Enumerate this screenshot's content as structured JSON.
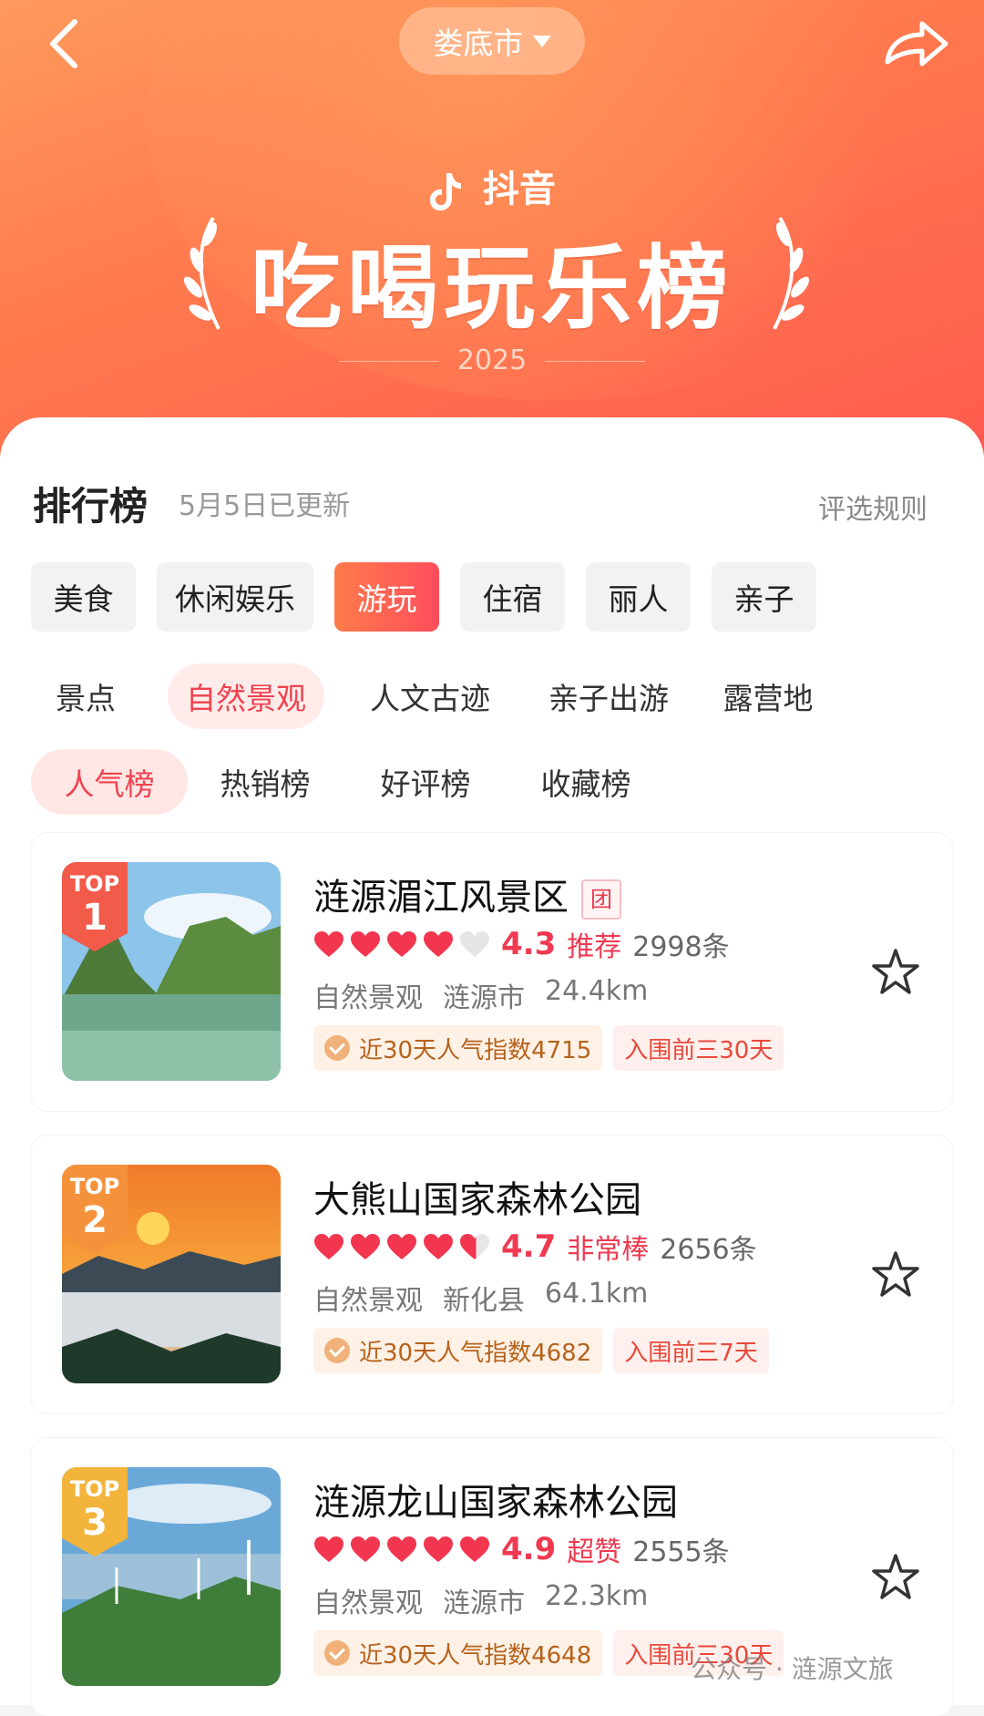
{
  "header": {
    "city": "娄底市",
    "brand": "抖音",
    "title": "吃喝玩乐榜",
    "year": "2025"
  },
  "section": {
    "title": "排行榜",
    "updated": "5月5日已更新",
    "rules": "评选规则"
  },
  "categories": [
    "美食",
    "休闲娱乐",
    "游玩",
    "住宿",
    "丽人",
    "亲子"
  ],
  "active_category": "游玩",
  "subcategories": [
    "景点",
    "自然景观",
    "人文古迹",
    "亲子出游",
    "露营地"
  ],
  "active_subcategory": "自然景观",
  "rank_types": [
    "人气榜",
    "热销榜",
    "好评榜",
    "收藏榜"
  ],
  "active_rank_type": "人气榜",
  "items": [
    {
      "top": "TOP",
      "rank": "1",
      "name": "涟源湄江风景区",
      "group_badge": "团",
      "score": "4.3",
      "word": "推荐",
      "count": "2998条",
      "type": "自然景观",
      "location": "涟源市",
      "distance": "24.4km",
      "tag1": "近30天人气指数4715",
      "tag2": "入围前三30天",
      "hearts": 4,
      "badge_color": "#f25a4a"
    },
    {
      "top": "TOP",
      "rank": "2",
      "name": "大熊山国家森林公园",
      "group_badge": "",
      "score": "4.7",
      "word": "非常棒",
      "count": "2656条",
      "type": "自然景观",
      "location": "新化县",
      "distance": "64.1km",
      "tag1": "近30天人气指数4682",
      "tag2": "入围前三7天",
      "hearts": 4.5,
      "badge_color": "#f4923c"
    },
    {
      "top": "TOP",
      "rank": "3",
      "name": "涟源龙山国家森林公园",
      "group_badge": "",
      "score": "4.9",
      "word": "超赞",
      "count": "2555条",
      "type": "自然景观",
      "location": "涟源市",
      "distance": "22.3km",
      "tag1": "近30天人气指数4648",
      "tag2": "入围前三30天",
      "hearts": 5,
      "badge_color": "#f2b43a"
    }
  ],
  "watermark": "公众号 · 涟源文旅",
  "colors": {
    "accent": "#ef3a52",
    "header_start": "#ff9a5c",
    "header_end": "#ff5a4f"
  }
}
